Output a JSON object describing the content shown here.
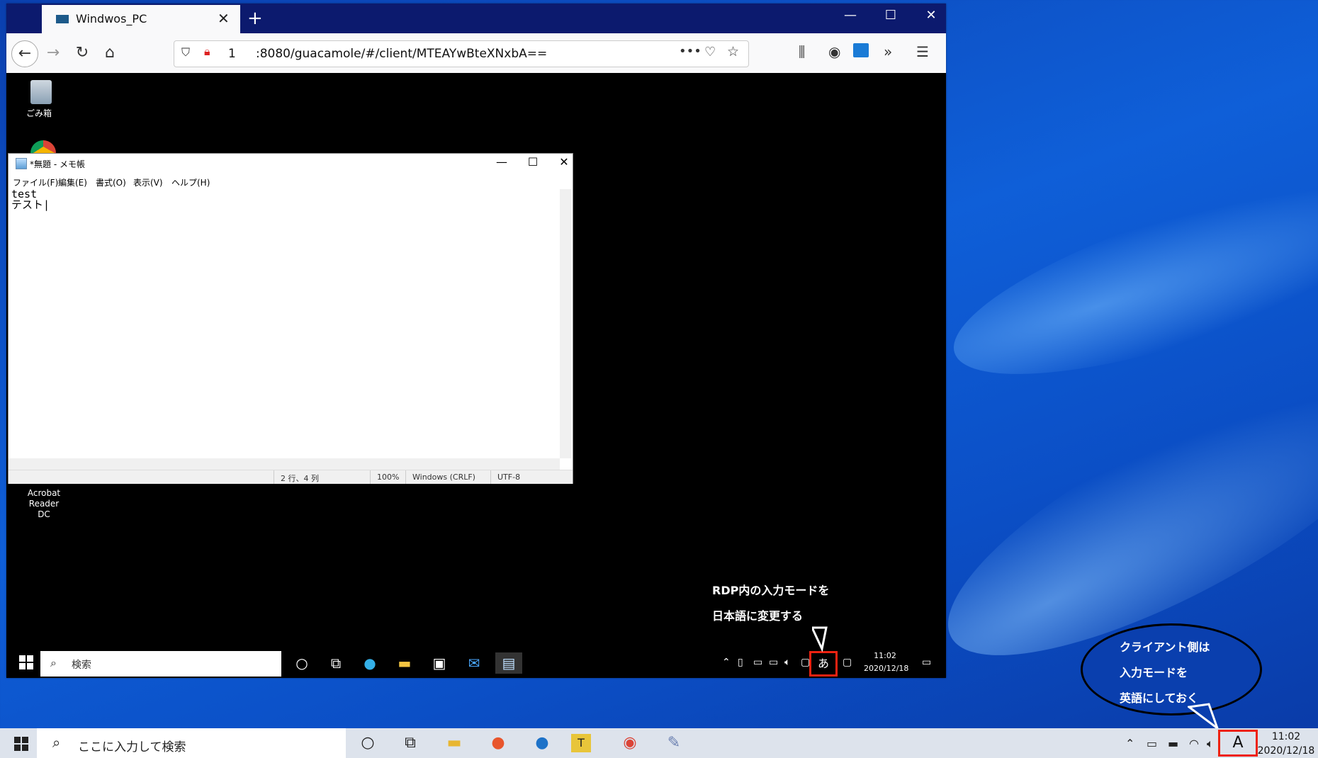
{
  "browser": {
    "tab_title": "Windwos_PC",
    "tab_close": "✕",
    "new_tab": "+",
    "minimize": "—",
    "maximize": "☐",
    "close": "✕",
    "url_host": "1",
    "url_path": ":8080/guacamole/#/client/MTEAYwBteXNxbA=="
  },
  "desktop": {
    "recycle_bin_label": "ごみ箱",
    "acrobat_label_line1": "Acrobat Reader",
    "acrobat_label_line2": "DC"
  },
  "notepad": {
    "title": "*無題 - メモ帳",
    "minimize": "—",
    "maximize": "☐",
    "close": "✕",
    "menu": [
      "ファイル(F)",
      "編集(E)",
      "書式(O)",
      "表示(V)",
      "ヘルプ(H)"
    ],
    "content": "test\nテスト|",
    "status_position": "2 行、4 列",
    "status_zoom": "100%",
    "status_eol": "Windows (CRLF)",
    "status_encoding": "UTF-8"
  },
  "rdp_taskbar": {
    "search_placeholder": "検索",
    "ime_mode": "あ",
    "time": "11:02",
    "date": "2020/12/18"
  },
  "callouts": {
    "rdp_line1": "RDP内の入力モードを",
    "rdp_line2": "日本語に変更する",
    "client_line1": "クライアント側は",
    "client_line2": "入力モードを",
    "client_line3": "英語にしておく"
  },
  "host_taskbar": {
    "search_placeholder": "ここに入力して検索",
    "ime_mode": "A",
    "time": "11:02",
    "date": "2020/12/18"
  },
  "colors": {
    "highlight_red": "#e21111",
    "browser_titlebar": "#0c1a6e",
    "desktop_blue": "#0f5fd8"
  }
}
